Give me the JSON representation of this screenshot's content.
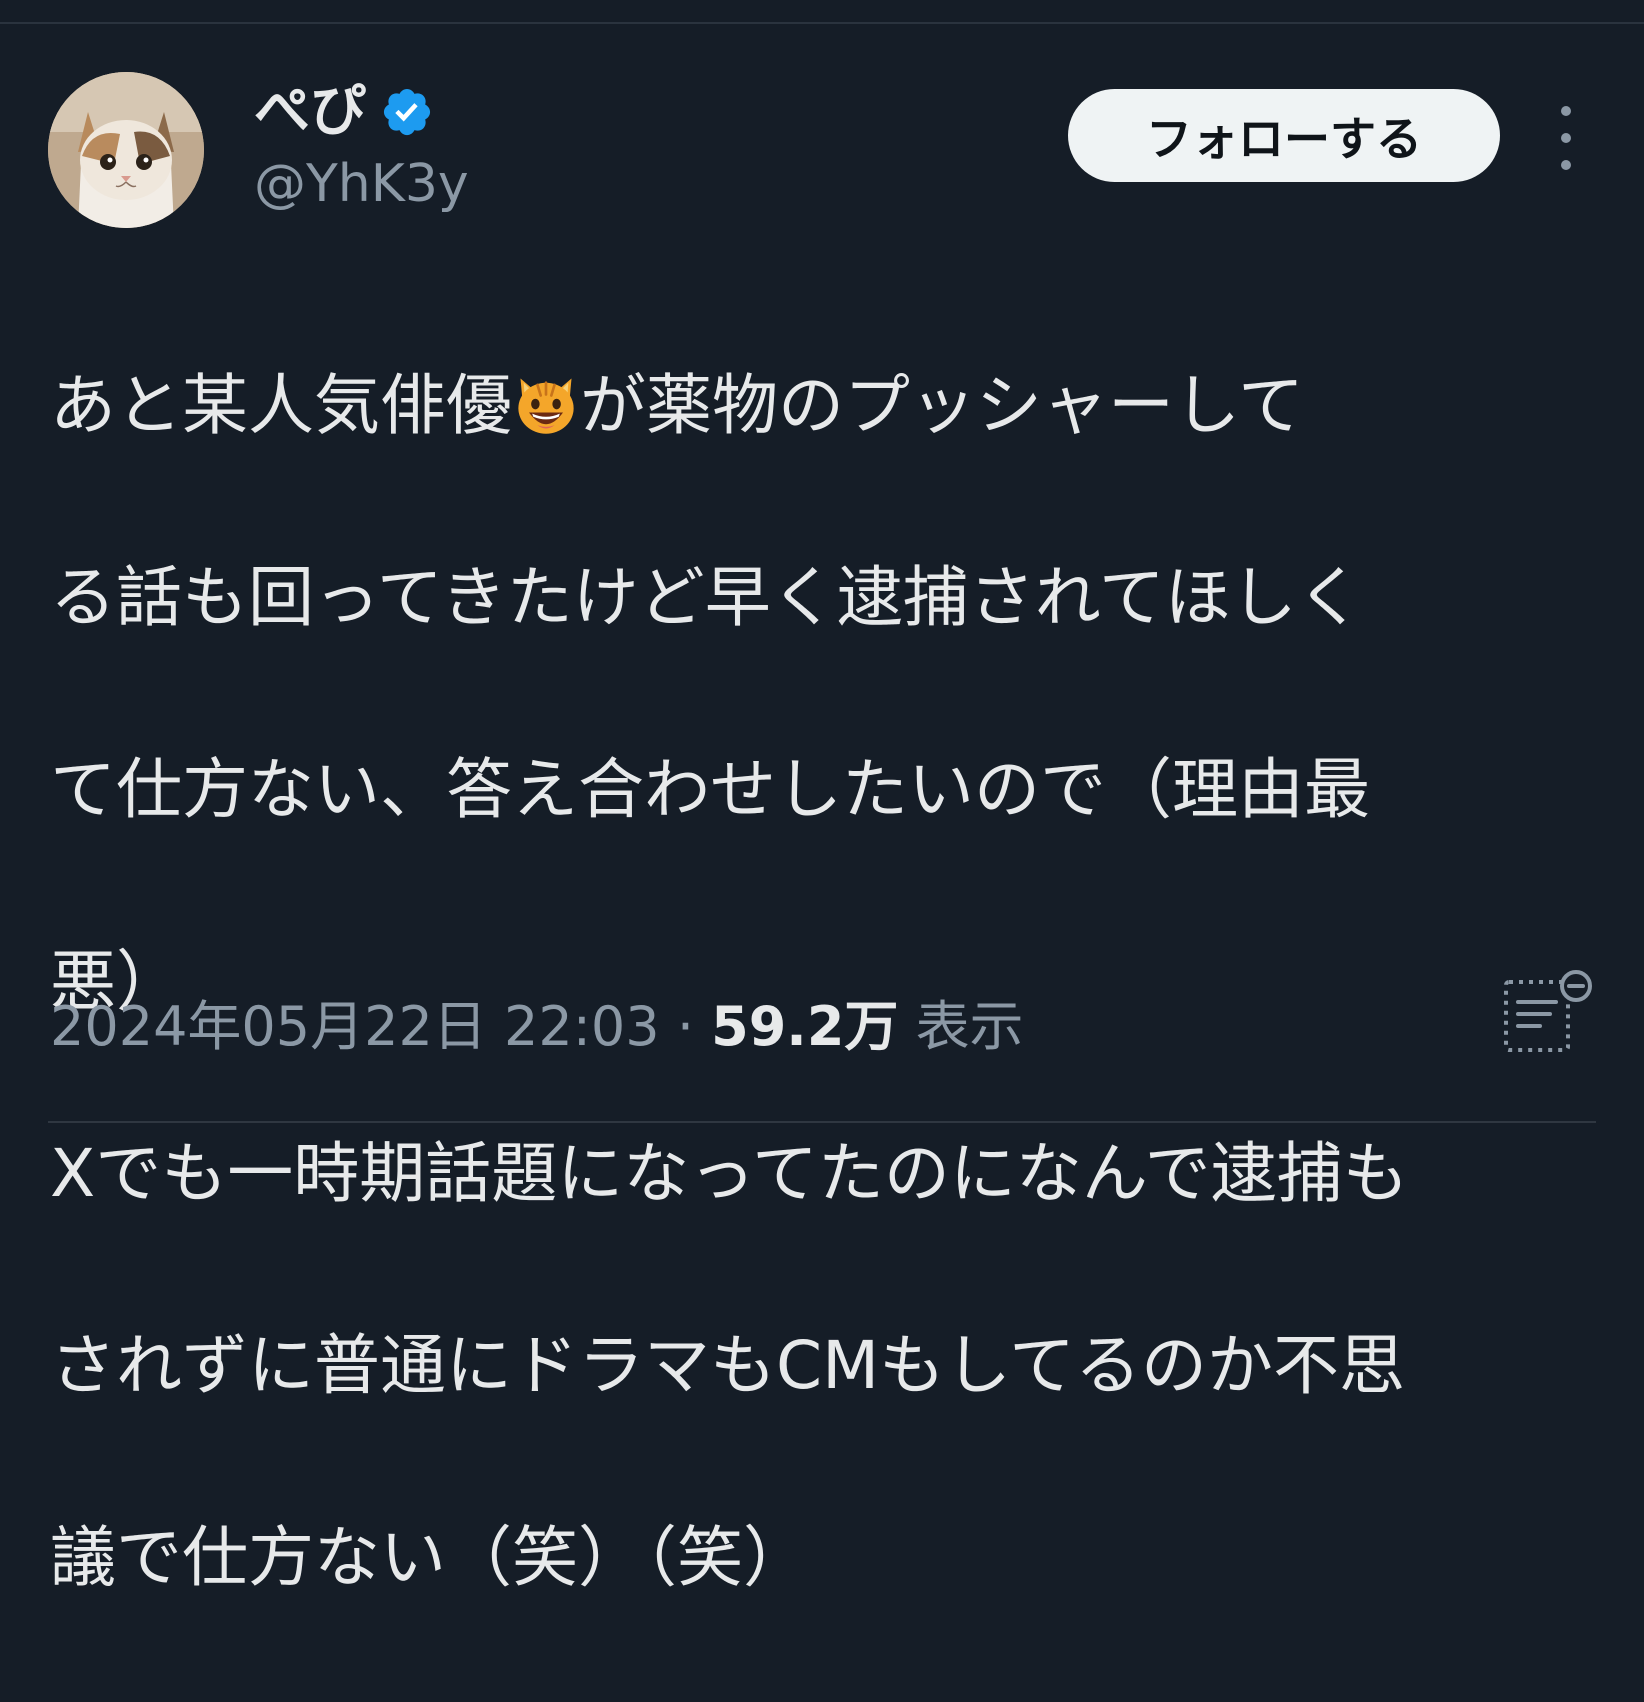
{
  "user": {
    "display_name": "ぺぴ",
    "handle": "@YhK3y",
    "verified": true
  },
  "follow_label": "フォローする",
  "tweet": {
    "lines": [
      {
        "before": "あと某人気俳優",
        "emoji": "grinning-cat-emoji",
        "after": "が薬物のプッシャーして"
      },
      {
        "text": "る話も回ってきたけど早く逮捕されてほしく"
      },
      {
        "text": "て仕方ない、答え合わせしたいので（理由最"
      },
      {
        "text": "悪）"
      },
      {
        "text": "Xでも一時期話題になってたのになんで逮捕も"
      },
      {
        "text": "されずに普通にドラマもCMもしてるのか不思"
      },
      {
        "text": "議で仕方ない（笑）（笑）"
      }
    ]
  },
  "meta": {
    "timestamp": "2024年05月22日 22:03",
    "separator": "·",
    "views_count": "59.2万",
    "views_label": "表示"
  },
  "icons": {
    "more": "more-vertical-icon",
    "analytics": "post-analytics-icon",
    "verified": "verified-badge-icon"
  },
  "colors": {
    "background": "#151d27",
    "text_primary": "#e7e9ea",
    "text_secondary": "#8b98a5",
    "verified_blue": "#1d9bf0",
    "follow_bg": "#eff3f4"
  }
}
